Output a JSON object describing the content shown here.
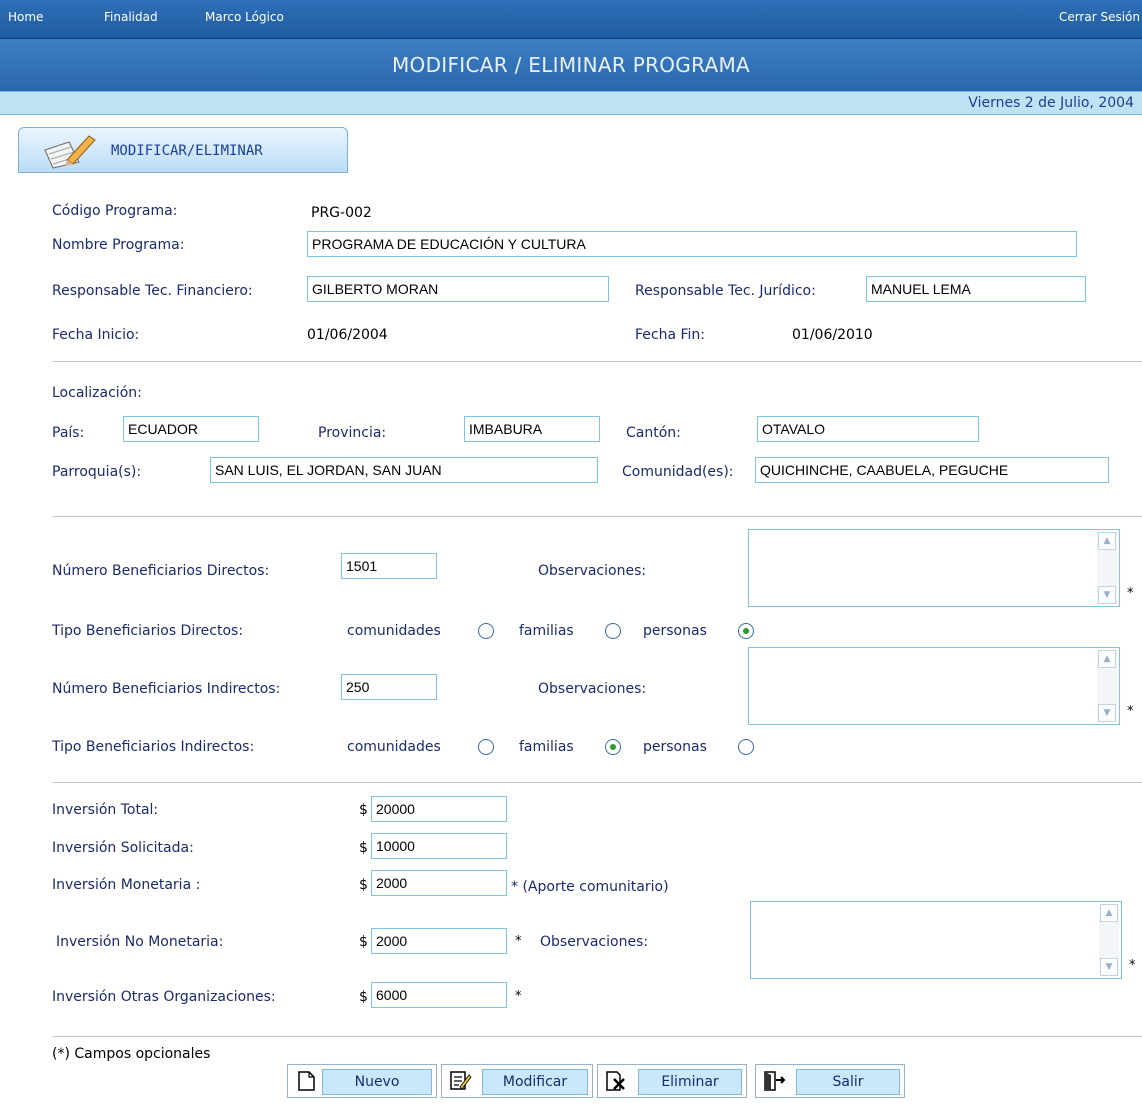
{
  "nav": {
    "home": "Home",
    "finalidad": "Finalidad",
    "marco": "Marco Lógico",
    "logout": "Cerrar Sesión"
  },
  "page_title": "MODIFICAR / ELIMINAR PROGRAMA",
  "date": "Viernes 2 de Julio, 2004",
  "tab_label": "MODIFICAR/ELIMINAR",
  "form": {
    "codigo_label": "Código Programa:",
    "codigo_value": "PRG-002",
    "nombre_label": "Nombre Programa:",
    "nombre_value": "PROGRAMA DE EDUCACIÓN Y CULTURA",
    "resp_fin_label": "Responsable Tec. Financiero:",
    "resp_fin_value": "GILBERTO MORAN",
    "resp_jur_label": "Responsable Tec. Jurídico:",
    "resp_jur_value": "MANUEL LEMA",
    "fecha_ini_label": "Fecha Inicio:",
    "fecha_ini_value": "01/06/2004",
    "fecha_fin_label": "Fecha Fin:",
    "fecha_fin_value": "01/06/2010"
  },
  "localizacion": {
    "title": "Localización:",
    "pais_label": "País:",
    "pais_value": "ECUADOR",
    "provincia_label": "Provincia:",
    "provincia_value": "IMBABURA",
    "canton_label": "Cantón:",
    "canton_value": "OTAVALO",
    "parroquia_label": "Parroquia(s):",
    "parroquia_value": "SAN LUIS, EL JORDAN, SAN JUAN",
    "comunidad_label": "Comunidad(es):",
    "comunidad_value": "QUICHINCHE, CAABUELA, PEGUCHE"
  },
  "beneficiarios": {
    "directos_label": "Número Beneficiarios Directos:",
    "directos_value": "1501",
    "observ_label": "Observaciones:",
    "tipo_directos_label": "Tipo Beneficiarios Directos:",
    "indirectos_label": "Número Beneficiarios Indirectos:",
    "indirectos_value": "250",
    "tipo_indirectos_label": "Tipo Beneficiarios Indirectos:",
    "opt_comunidades": "comunidades",
    "opt_familias": "familias",
    "opt_personas": "personas",
    "directos_selected": "personas",
    "indirectos_selected": "familias",
    "star": "*"
  },
  "inversion": {
    "currency": "$",
    "total_label": "Inversión Total:",
    "total_value": "20000",
    "solicitada_label": "Inversión Solicitada:",
    "solicitada_value": "10000",
    "monetaria_label": "Inversión Monetaria :",
    "monetaria_value": "2000",
    "aporte_note": "* (Aporte comunitario)",
    "no_monetaria_label": "Inversión No Monetaria:",
    "no_monetaria_value": "2000",
    "otras_label": "Inversión Otras Organizaciones:",
    "otras_value": "6000",
    "observ_label": "Observaciones:"
  },
  "footer_note": "(*) Campos opcionales",
  "buttons": {
    "nuevo": "Nuevo",
    "modificar": "Modificar",
    "eliminar": "Eliminar",
    "salir": "Salir"
  },
  "colors": {
    "nav_bg": "#2569b0",
    "date_bar": "#bfe2f5",
    "input_border": "#7fc3e6",
    "radio_selected": "#2a9a2a"
  }
}
